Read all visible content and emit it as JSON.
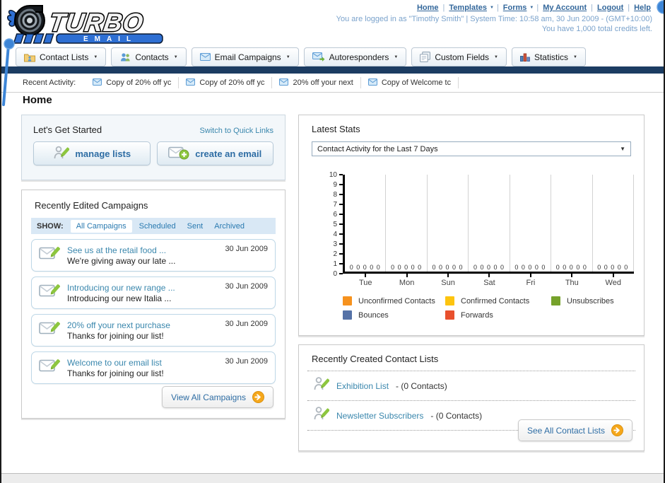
{
  "header": {
    "logo_line1": "TURBO",
    "logo_line2": "EMAIL",
    "nav": [
      {
        "label": "Home",
        "dropdown": false
      },
      {
        "label": "Templates",
        "dropdown": true
      },
      {
        "label": "Forms",
        "dropdown": true
      },
      {
        "label": "My Account",
        "dropdown": false
      },
      {
        "label": "Logout",
        "dropdown": false
      },
      {
        "label": "Help",
        "dropdown": false
      }
    ],
    "login_status": "You are logged in as \"Timothy Smith\" | System Time: 10:58 am, 30 Jun 2009 - (GMT+10:00)",
    "credits": "You have 1,000 total credits left."
  },
  "tabs": [
    {
      "label": "Contact Lists",
      "icon": "contact-lists-icon"
    },
    {
      "label": "Contacts",
      "icon": "contacts-icon"
    },
    {
      "label": "Email Campaigns",
      "icon": "email-campaigns-icon"
    },
    {
      "label": "Autoresponders",
      "icon": "autoresponders-icon"
    },
    {
      "label": "Custom Fields",
      "icon": "custom-fields-icon"
    },
    {
      "label": "Statistics",
      "icon": "statistics-icon"
    }
  ],
  "recent_activity": {
    "label": "Recent Activity:",
    "items": [
      "Copy of 20% off yc",
      "Copy of 20% off yc",
      "20% off your next",
      "Copy of Welcome tc"
    ]
  },
  "page_title": "Home",
  "get_started": {
    "title": "Let's Get Started",
    "switch_link": "Switch to Quick Links",
    "buttons": [
      {
        "label": "manage lists",
        "icon": "manage-lists-icon"
      },
      {
        "label": "create an email",
        "icon": "create-email-icon"
      }
    ]
  },
  "campaigns": {
    "title": "Recently Edited Campaigns",
    "show_label": "SHOW:",
    "filters": [
      {
        "label": "All Campaigns",
        "active": true
      },
      {
        "label": "Scheduled",
        "active": false
      },
      {
        "label": "Sent",
        "active": false
      },
      {
        "label": "Archived",
        "active": false
      }
    ],
    "items": [
      {
        "title": "See us at the retail food ...",
        "subtitle": "We're giving away our late ...",
        "date": "30 Jun 2009"
      },
      {
        "title": "Introducing our new range ...",
        "subtitle": "Introducing our new Italia ...",
        "date": "30 Jun 2009"
      },
      {
        "title": "20% off your next purchase",
        "subtitle": "Thanks for joining our list!",
        "date": "30 Jun 2009"
      },
      {
        "title": "Welcome to our email list",
        "subtitle": "Thanks for joining our list!",
        "date": "30 Jun 2009"
      }
    ],
    "view_all": "View All Campaigns"
  },
  "stats": {
    "title": "Latest Stats",
    "dropdown_value": "Contact Activity for the Last 7 Days"
  },
  "chart_data": {
    "type": "bar",
    "title": "Contact Activity for the Last 7 Days",
    "categories": [
      "Tue",
      "Mon",
      "Sun",
      "Sat",
      "Fri",
      "Thu",
      "Wed"
    ],
    "series": [
      {
        "name": "Unconfirmed Contacts",
        "color": "#F6921E",
        "values": [
          0,
          0,
          0,
          0,
          0,
          0,
          0
        ]
      },
      {
        "name": "Confirmed Contacts",
        "color": "#FDC40F",
        "values": [
          0,
          0,
          0,
          0,
          0,
          0,
          0
        ]
      },
      {
        "name": "Unsubscribes",
        "color": "#76A22B",
        "values": [
          0,
          0,
          0,
          0,
          0,
          0,
          0
        ]
      },
      {
        "name": "Bounces",
        "color": "#5572A7",
        "values": [
          0,
          0,
          0,
          0,
          0,
          0,
          0
        ]
      },
      {
        "name": "Forwards",
        "color": "#E8502D",
        "values": [
          0,
          0,
          0,
          0,
          0,
          0,
          0
        ]
      }
    ],
    "ylim": [
      0,
      10
    ],
    "yticks": [
      0,
      1,
      2,
      3,
      4,
      5,
      6,
      7,
      8,
      9,
      10
    ],
    "grid": true,
    "legend_position": "bottom"
  },
  "contact_lists": {
    "title": "Recently Created Contact Lists",
    "items": [
      {
        "name": "Exhibition List",
        "detail": "- (0 Contacts)"
      },
      {
        "name": "Newsletter Subscribers",
        "detail": "- (0 Contacts)"
      }
    ],
    "see_all": "See All Contact Lists"
  },
  "colors": {
    "navy_bar": "#1c3c62",
    "top_link": "#33679b",
    "content_link": "#3a87ad",
    "button_text": "#2e6da4",
    "orange_arrow": "#f5a71b",
    "show_bar_bg": "#d9e8f5",
    "annotation_pin": "#3d85d6"
  }
}
